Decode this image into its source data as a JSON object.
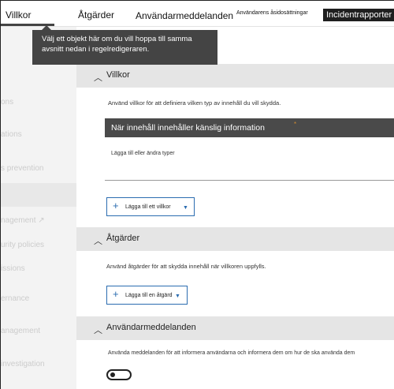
{
  "nav": {
    "tab_villkor": "Villkor",
    "tab_atgarder": "Åtgärder",
    "tab_anvandarmeddelanden": "Användarmeddelanden",
    "tab_asidosattningar": "Användarens åsidosättningar",
    "tab_incidentrapporter": "Incidentrapporter"
  },
  "tooltip": {
    "text": "Välj ett objekt här om du vill hoppa till samma avsnitt nedan i regelredigeraren."
  },
  "sidebar": {
    "items": [
      {
        "label": "ons"
      },
      {
        "label": "ations"
      },
      {
        "label": "s prevention"
      },
      {
        "label": "nagement ↗"
      },
      {
        "label": "urity policies"
      },
      {
        "label": "issions"
      },
      {
        "label": "ernance"
      },
      {
        "label": "anagement"
      },
      {
        "label": "investigation"
      }
    ]
  },
  "conditions": {
    "title": "Villkor",
    "description": "Använd villkor för att definiera vilken typ av innehåll du vill skydda.",
    "bar_text": "När innehåll innehåller känslig information",
    "bar_marker": "*",
    "add_types": "Lägga till eller ändra typer",
    "add_button": "Lägga till ett villkor"
  },
  "actions": {
    "title": "Åtgärder",
    "description": "Använd åtgärder för att skydda innehåll när villkoren uppfylls.",
    "add_button": "Lägga till en åtgärd"
  },
  "notifications": {
    "title": "Användarmeddelanden",
    "description": "Använda meddelanden för att informera användarna och informera dem om hur de ska använda dem",
    "toggle_on": false
  },
  "colors": {
    "accent": "#2b6cb0",
    "section_header": "#e5e5e5",
    "tooltip_bg": "#444444",
    "dark_bar": "#4a4a4a"
  },
  "icons": {
    "chevron": "chevron-up-icon",
    "plus": "plus-icon",
    "caret": "chevron-down-icon"
  }
}
